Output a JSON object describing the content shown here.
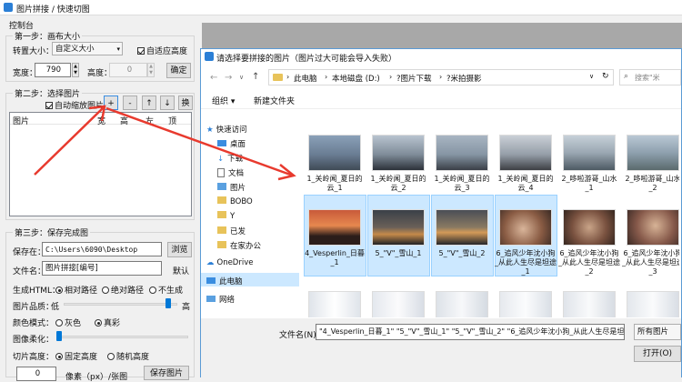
{
  "main_window": {
    "title": "图片拼接 / 快速切图",
    "menu": "控制台"
  },
  "step1": {
    "title": "第一步：画布大小",
    "size_label": "转置大小：",
    "size_value": "自定义大小",
    "adaptive_height_label": "自适应高度",
    "width_label": "宽度：",
    "width_value": "790",
    "height_label": "高度：",
    "height_value": "0",
    "confirm_button": "确定"
  },
  "step2": {
    "title": "第二步：选择图片",
    "auto_scale_label": "自动缩放图片",
    "add_button": "+",
    "remove_button": "-",
    "up_button": "↑",
    "down_button": "↓",
    "replace_button": "换",
    "columns": [
      "图片",
      "宽",
      "高",
      "左",
      "顶"
    ]
  },
  "step3": {
    "title": "第三步：保存完成图",
    "save_in_label": "保存在：",
    "save_path": "C:\\Users\\6090\\Desktop",
    "browse_button": "浏览",
    "filename_label": "文件名：",
    "filename_value": "图片拼接[编号]",
    "default_button": "默认",
    "html_label": "生成HTML：",
    "html_options": [
      "相对路径",
      "绝对路径",
      "不生成"
    ],
    "quality_label": "图片品质：",
    "quality_low": "低",
    "quality_high": "高",
    "color_label": "颜色模式：",
    "color_options": [
      "灰色",
      "真彩"
    ],
    "blur_label": "图像柔化：",
    "slice_label": "切片高度：",
    "slice_options": [
      "固定高度",
      "随机高度"
    ],
    "slice_value": "0",
    "slice_unit": "像素（px）/张图",
    "save_button": "保存图片"
  },
  "dialog": {
    "title": "请选择要拼接的图片（图片过大可能会导入失败）",
    "breadcrumb": [
      "此电脑",
      "本地磁盘 (D:)",
      "?图片下载",
      "?米拍摄影"
    ],
    "search_placeholder": "搜索\"米",
    "organize_button": "组织 ▾",
    "new_folder_button": "新建文件夹",
    "nav_items": [
      "快速访问",
      "桌面",
      "下载",
      "文档",
      "图片",
      "BOBO",
      "Y",
      "已发",
      "在家办公",
      "OneDrive",
      "此电脑",
      "网络"
    ],
    "files": [
      {
        "name": "1_关岭闻_夏日的云_1",
        "selected": false
      },
      {
        "name": "1_关岭闻_夏日的云_2",
        "selected": false
      },
      {
        "name": "1_关岭闻_夏日的云_3",
        "selected": false
      },
      {
        "name": "1_关岭闻_夏日的云_4",
        "selected": false
      },
      {
        "name": "2_哆啦游哥_山水_1",
        "selected": false
      },
      {
        "name": "2_哆啦游哥_山水_2",
        "selected": false
      },
      {
        "name": "4_Vesperlin_日暮_1",
        "selected": true
      },
      {
        "name": "5_\"V\"_雪山_1",
        "selected": true
      },
      {
        "name": "5_\"V\"_雪山_2",
        "selected": true
      },
      {
        "name": "6_追风少年沈小狗_从此人生尽是坦途_1",
        "selected": true
      },
      {
        "name": "6_追风少年沈小狗_从此人生尽是坦途_2",
        "selected": false
      },
      {
        "name": "6_追风少年沈小狗_从此人生尽是坦途_3",
        "selected": false
      }
    ],
    "filename_label": "文件名(N):",
    "filename_value": "\"4_Vesperlin_日暮_1\" \"5_\"V\"_雪山_1\" \"5_\"V\"_雪山_2\" \"6_追风少年沈小狗_从此人生尽是坦途_1\"",
    "filetype_value": "所有图片",
    "open_button": "打开(O)"
  }
}
